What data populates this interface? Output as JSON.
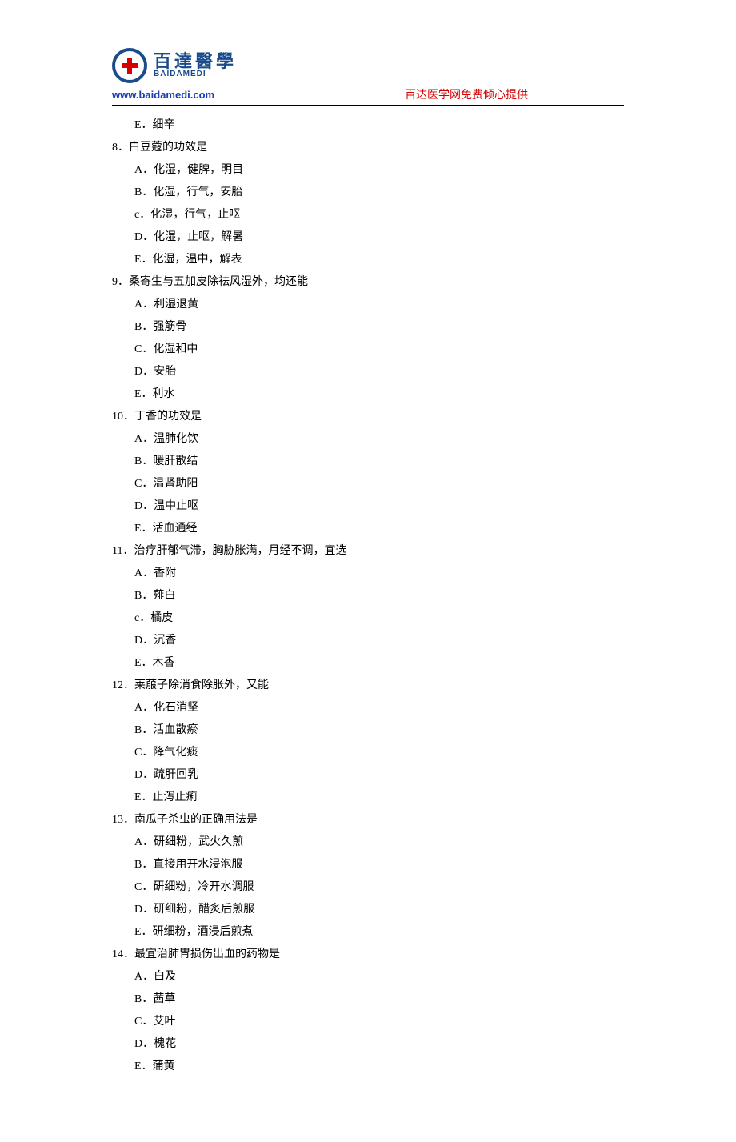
{
  "header": {
    "brand_zh": "百達醫學",
    "brand_en": "BAIDAMEDI",
    "url": "www.baidamedi.com",
    "tagline": "百达医学网免费倾心提供"
  },
  "fragment_option": "E．细辛",
  "questions": [
    {
      "q": "8．白豆蔻的功效是",
      "opts": [
        "A．化湿，健脾，明目",
        "B．化湿，行气，安胎",
        "c．化湿，行气，止呕",
        "D．化湿，止呕，解暑",
        "E．化湿，温中，解表"
      ]
    },
    {
      "q": "9．桑寄生与五加皮除祛风湿外，均还能",
      "opts": [
        "A．利湿退黄",
        "B．强筋骨",
        "C．化湿和中",
        "D．安胎",
        "E．利水"
      ]
    },
    {
      "q": "10．丁香的功效是",
      "opts": [
        "A．温肺化饮",
        "B．暖肝散结",
        "C．温肾助阳",
        "D．温中止呕",
        "E．活血通经"
      ]
    },
    {
      "q": "11．治疗肝郁气滞，胸胁胀满，月经不调，宜选",
      "opts": [
        "A．香附",
        "B．薤白",
        "c．橘皮",
        "D．沉香",
        "E．木香"
      ]
    },
    {
      "q": "12．莱菔子除消食除胀外，又能",
      "opts": [
        "A．化石消坚",
        "B．活血散瘀",
        "C．降气化痰",
        "D．疏肝回乳",
        "E．止泻止痢"
      ]
    },
    {
      "q": "13．南瓜子杀虫的正确用法是",
      "opts": [
        "A．研细粉，武火久煎",
        "B．直接用开水浸泡服",
        "C．研细粉，冷开水调服",
        "D．研细粉，醋炙后煎服",
        "E．研细粉，酒浸后煎煮"
      ]
    },
    {
      "q": "14．最宜治肺胃损伤出血的药物是",
      "opts": [
        "A．白及",
        "B．茜草",
        "C．艾叶",
        "D．槐花",
        "E．蒲黄"
      ]
    }
  ]
}
